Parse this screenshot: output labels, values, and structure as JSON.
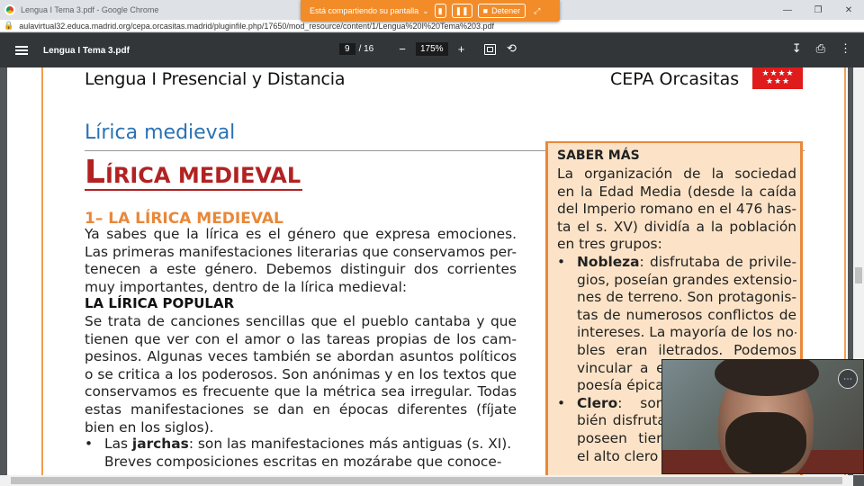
{
  "browser": {
    "tab_title": "Lengua I Tema 3.pdf - Google Chrome",
    "url": "aulavirtual32.educa.madrid.org/cepa.orcasitas.madrid/pluginfile.php/17650/mod_resource/content/1/Lengua%20I%20Tema%203.pdf"
  },
  "sharing": {
    "status": "Está compartiendo su pantalla",
    "stop_label": "Detener"
  },
  "pdf_toolbar": {
    "doc_title": "Lengua I Tema 3.pdf",
    "current_page": "9",
    "total_pages": "/ 16",
    "zoom": "175%"
  },
  "page": {
    "header_left": "Lengua I Presencial y Distancia",
    "header_right": "CEPA Orcasitas",
    "section_title": "Lírica medieval",
    "main_heading_initial": "L",
    "main_heading_rest": "ÍRICA MEDIEVAL",
    "sub_heading": "1– LA LÍRICA MEDIEVAL",
    "intro_lines": [
      "Ya sabes que la lírica es el género que expresa emociones.",
      "Las primeras manifestaciones literarias que conservamos per-",
      "tenecen a este género. Debemos distinguir dos corrientes",
      "muy importantes, dentro de la lírica medieval:"
    ],
    "popular_heading": "LA LÍRICA POPULAR",
    "popular_lines": [
      "Se trata de canciones sencillas que el pueblo cantaba y que",
      "tienen que ver con el amor o las tareas propias de los cam-",
      "pesinos. Algunas veces también se abordan asuntos políticos",
      "o se critica a los poderosos. Son anónimas y en los textos que",
      "conservamos es frecuente que la métrica sea irregular. Todas",
      "estas manifestaciones se dan en épocas diferentes (fíjate",
      "bien en los siglos)."
    ],
    "bullet1_pre": "Las ",
    "bullet1_bold": "jarchas",
    "bullet1_post": ": son las manifestaciones más antiguas (s. XI).",
    "bullet1_next": "Breves composiciones escritas en mozárabe que conoce-"
  },
  "saber_mas": {
    "title": "SABER MÁS",
    "lines": [
      "La organización de la sociedad",
      "en la Edad Media (desde la caída",
      "del Imperio romano en el 476 has-",
      "ta el s. XV) dividía a la población",
      "en tres grupos:"
    ],
    "nobleza_bold": "Nobleza",
    "nobleza_first": ": disfrutaba de privile-",
    "nobleza_lines": [
      "gios, poseían grandes extensio-",
      "nes de terreno. Son protagonis-",
      "tas de numerosos conflictos de",
      "intereses. La mayoría de los no-",
      "bles eran iletrados. Podemos",
      "vincular a estos personajes la",
      "poesía épica."
    ],
    "clero_bold": "Clero",
    "clero_first": ": son los que tam-",
    "clero_lines": [
      "bién disfrutaban de privilegios,",
      "poseen tierras. Pertenecen a",
      "el alto clero y el bajo clero."
    ]
  },
  "icons": {
    "menu": "menu-icon",
    "download": "download-icon",
    "print": "print-icon",
    "more": "more-vert-icon"
  }
}
